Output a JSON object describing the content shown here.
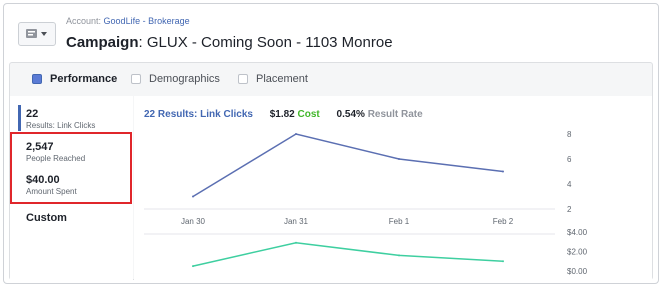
{
  "account_prefix": "Account:",
  "account_name": "GoodLife - Brokerage",
  "campaign_label": "Campaign",
  "campaign_name": "GLUX - Coming Soon - 1103 Monroe",
  "tabs": [
    {
      "label": "Performance",
      "active": true
    },
    {
      "label": "Demographics",
      "active": false
    },
    {
      "label": "Placement",
      "active": false
    }
  ],
  "sidebar": {
    "items": [
      {
        "value": "22",
        "label": "Results: Link Clicks"
      },
      {
        "value": "2,547",
        "label": "People Reached"
      },
      {
        "value": "$40.00",
        "label": "Amount Spent"
      }
    ],
    "custom_label": "Custom"
  },
  "metrics": {
    "results_value": "22",
    "results_label": "Results: Link Clicks",
    "cost_value": "$1.82",
    "cost_label": "Cost",
    "rate_value": "0.54%",
    "rate_label": "Result Rate"
  },
  "colors": {
    "results_line": "#5b6fb2",
    "cost_line": "#3ecfa0",
    "highlight": "#e0262b",
    "accent": "#4267b2"
  },
  "chart_data": [
    {
      "type": "line",
      "x": [
        "Jan 30",
        "Jan 31",
        "Feb 1",
        "Feb 2"
      ],
      "series": [
        {
          "name": "Results: Link Clicks",
          "values": [
            3,
            8,
            6,
            5
          ]
        }
      ],
      "yticks": [
        "8",
        "6",
        "4",
        "2"
      ],
      "ylim": [
        2,
        8
      ]
    },
    {
      "type": "line",
      "x": [
        "Jan 30",
        "Jan 31",
        "Feb 1",
        "Feb 2"
      ],
      "series": [
        {
          "name": "Cost",
          "values": [
            0.5,
            2.9,
            1.6,
            1.0
          ]
        }
      ],
      "yticks": [
        "$4.00",
        "$2.00",
        "$0.00"
      ],
      "ylim": [
        0,
        4
      ]
    }
  ]
}
